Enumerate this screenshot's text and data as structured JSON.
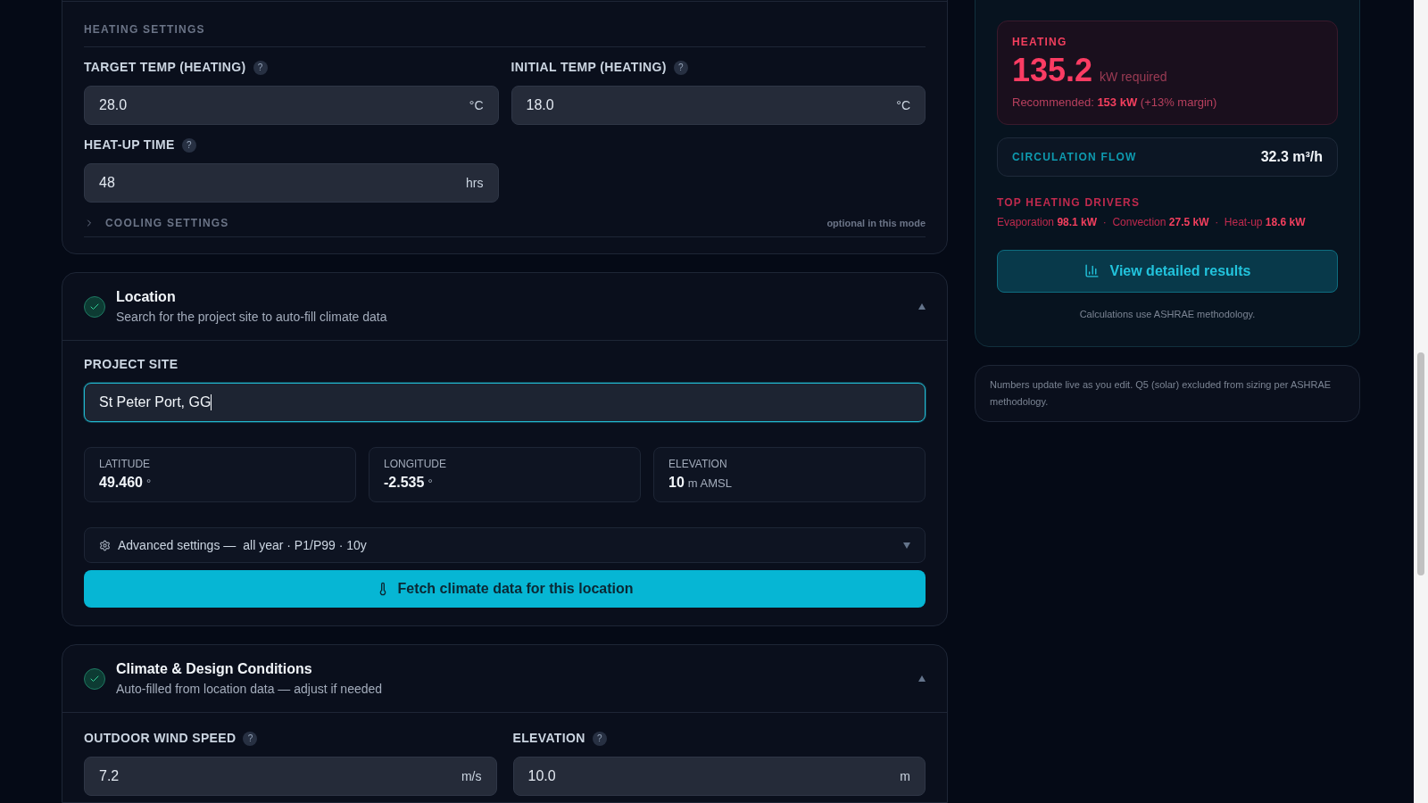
{
  "heating_settings": {
    "title": "HEATING SETTINGS",
    "fields": [
      {
        "label": "TARGET TEMP (HEATING)",
        "help": "?",
        "value": "28.0",
        "unit": "°C"
      },
      {
        "label": "INITIAL TEMP (HEATING)",
        "help": "?",
        "value": "18.0",
        "unit": "°C"
      },
      {
        "label": "HEAT-UP TIME",
        "help": "?",
        "value": "48",
        "unit": "hrs"
      }
    ],
    "cooling": {
      "label": "COOLING SETTINGS",
      "note": "optional in this mode",
      "expanded": false
    }
  },
  "location": {
    "title": "Location",
    "subtitle": "Search for the project site to auto-fill climate data",
    "complete": true,
    "expanded": true,
    "project_site": {
      "label": "PROJECT SITE",
      "value": "St Peter Port, GG"
    },
    "coords": [
      {
        "label": "LATITUDE",
        "value": "49.460",
        "unit": "°"
      },
      {
        "label": "LONGITUDE",
        "value": "-2.535",
        "unit": "°"
      },
      {
        "label": "ELEVATION",
        "value": "10",
        "unit": "m AMSL"
      }
    ],
    "advanced": {
      "label": "Advanced settings —",
      "summary": "all year · P1/P99 · 10y",
      "expanded": false
    },
    "fetch_button": "Fetch climate data for this location"
  },
  "climate": {
    "title": "Climate & Design Conditions",
    "subtitle": "Auto-filled from location data — adjust if needed",
    "complete": true,
    "expanded": true,
    "fields": [
      {
        "label": "OUTDOOR WIND SPEED",
        "help": "?",
        "value": "7.2",
        "unit": "m/s"
      },
      {
        "label": "ELEVATION",
        "help": "?",
        "value": "10.0",
        "unit": "m"
      }
    ]
  },
  "results": {
    "heating": {
      "label": "HEATING",
      "value": "135.2",
      "unit": "kW required",
      "recommended": "Recommended: **153 kW** (+13% margin)"
    },
    "flow": {
      "label": "CIRCULATION FLOW",
      "value": "32.3 m³/h"
    },
    "drivers": {
      "title": "TOP HEATING DRIVERS",
      "text": "Evaporation **98.1 kW**  ·  Convection **27.5 kW**  ·  Heat-up **18.6 kW**"
    },
    "button": "View detailed results",
    "footnote": "Calculations use ASHRAE methodology."
  },
  "note": "Numbers update live as you edit. Q5 (solar) excluded from sizing per ASHRAE methodology."
}
